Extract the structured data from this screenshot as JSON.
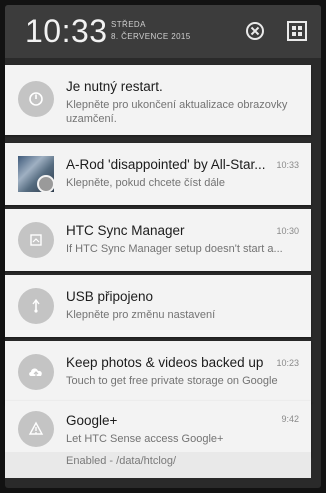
{
  "status": {
    "time": "10:33",
    "day": "STŘEDA",
    "date": "8. ČERVENCE 2015"
  },
  "header": {
    "clear_icon": "close-circle-icon",
    "settings_icon": "quick-settings-icon"
  },
  "notifications": [
    {
      "title": "Je nutný restart.",
      "text": "Klepněte pro ukončení aktualizace obrazovky uzamčení.",
      "time": "",
      "icon": "power-icon"
    },
    {
      "title": "A-Rod 'disappointed' by All-Star...",
      "text": "Klepněte, pokud chcete číst dále",
      "time": "10:33",
      "icon": "news-photo"
    },
    {
      "title": "HTC Sync Manager",
      "text": "If HTC Sync Manager setup doesn't start a...",
      "time": "10:30",
      "icon": "sync-icon"
    },
    {
      "title": "USB připojeno",
      "text": "Klepněte pro změnu nastavení",
      "time": "",
      "icon": "usb-icon"
    },
    {
      "title": "Keep photos & videos backed up",
      "text": "Touch to get free private storage on Google",
      "time": "10:23",
      "icon": "cloud-upload-icon"
    },
    {
      "title": "Google+",
      "text": "Let HTC Sense access Google+",
      "time": "9:42",
      "icon": "warning-icon"
    }
  ],
  "peek": {
    "text": "Enabled - /data/htclog/"
  }
}
